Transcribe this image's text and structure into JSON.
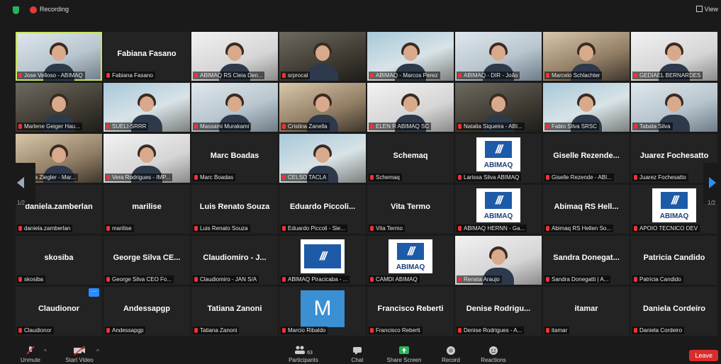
{
  "topbar": {
    "recording_label": "Recording",
    "view_label": "View"
  },
  "pagination": {
    "left_page": "1/2",
    "right_page": "1/2"
  },
  "tiles": [
    {
      "name": "Jose Velloso - ABIMAQ",
      "kind": "video",
      "active": true
    },
    {
      "name": "Fabiana Fasano",
      "kind": "name",
      "display": "Fabiana Fasano"
    },
    {
      "name": "ABIMAQ RS Cleia Den...",
      "kind": "video"
    },
    {
      "name": "srprocal",
      "kind": "video"
    },
    {
      "name": "ABIMAQ - Marcos Perez",
      "kind": "video"
    },
    {
      "name": "ABIMAQ - DIR - João",
      "kind": "video"
    },
    {
      "name": "Marcelo Schlachter",
      "kind": "video"
    },
    {
      "name": "GEDIAEL BERNARDES",
      "kind": "video"
    },
    {
      "name": "Marlene Geiger Hau...",
      "kind": "video"
    },
    {
      "name": "SUELI-SRRR",
      "kind": "video"
    },
    {
      "name": "Massami Murakami",
      "kind": "video"
    },
    {
      "name": "Cristina Zanella",
      "kind": "video"
    },
    {
      "name": "ELEN R ABIMAQ SC",
      "kind": "video"
    },
    {
      "name": "Natalia Siqueira - ABI...",
      "kind": "video"
    },
    {
      "name": "Fabio Silva SRSC",
      "kind": "video"
    },
    {
      "name": "Tabata Silva",
      "kind": "video"
    },
    {
      "name": "Lucia Ziegler - Mar...",
      "kind": "video"
    },
    {
      "name": "Vera Rodrigues - IMP...",
      "kind": "video"
    },
    {
      "name": "Marc Boadas",
      "kind": "name",
      "display": "Marc Boadas"
    },
    {
      "name": "CELSO TACLA",
      "kind": "video"
    },
    {
      "name": "Schemaq",
      "kind": "name",
      "display": "Schemaq"
    },
    {
      "name": "Larissa Silva ABIMAQ",
      "kind": "logo"
    },
    {
      "name": "Giselle Rezende - ABI...",
      "kind": "name",
      "display": "Giselle Rezende..."
    },
    {
      "name": "Juarez Fochesatto",
      "kind": "name",
      "display": "Juarez Fochesatto"
    },
    {
      "name": "daniela.zamberlan",
      "kind": "name",
      "display": "daniela.zamberlan"
    },
    {
      "name": "marilise",
      "kind": "name",
      "display": "marilise"
    },
    {
      "name": "Luis Renato Souza",
      "kind": "name",
      "display": "Luis Renato Souza"
    },
    {
      "name": "Eduardo Piccoli - Sie...",
      "kind": "name",
      "display": "Eduardo Piccoli..."
    },
    {
      "name": "Vita Termo",
      "kind": "name",
      "display": "Vita Termo"
    },
    {
      "name": "ABIMAQ HERNN - Ga...",
      "kind": "logo"
    },
    {
      "name": "Abimaq RS Hellen So...",
      "kind": "name",
      "display": "Abimaq RS Hell..."
    },
    {
      "name": "APOIO TECNICO DEV",
      "kind": "logo"
    },
    {
      "name": "skosiba",
      "kind": "name",
      "display": "skosiba"
    },
    {
      "name": "George Silva CEO Fo...",
      "kind": "name",
      "display": "George Silva CE..."
    },
    {
      "name": "Claudiomiro - JAN S/A",
      "kind": "name",
      "display": "Claudiomiro - J..."
    },
    {
      "name": "ABIMAQ Piracicaba - ...",
      "kind": "logo2"
    },
    {
      "name": "CAMDI ABIMAQ",
      "kind": "logo"
    },
    {
      "name": "Renata Araujo",
      "kind": "video"
    },
    {
      "name": "Sandra Donegatti | A...",
      "kind": "name",
      "display": "Sandra Donegat..."
    },
    {
      "name": "Patricia Candido",
      "kind": "name",
      "display": "Patricia Candido"
    },
    {
      "name": "Claudionor",
      "kind": "name",
      "display": "Claudionor",
      "more": true
    },
    {
      "name": "Andessapgp",
      "kind": "name",
      "display": "Andessapgp"
    },
    {
      "name": "Tatiana Zanoni",
      "kind": "name",
      "display": "Tatiana Zanoni"
    },
    {
      "name": "Marcio Ribaldo",
      "kind": "mcard",
      "initial": "M"
    },
    {
      "name": "Francisco Reberti",
      "kind": "name",
      "display": "Francisco Reberti"
    },
    {
      "name": "Denise Rodrigues - A...",
      "kind": "name",
      "display": "Denise Rodrigu..."
    },
    {
      "name": "itamar",
      "kind": "name",
      "display": "itamar"
    },
    {
      "name": "Daniela Cordeiro",
      "kind": "name",
      "display": "Daniela Cordeiro"
    }
  ],
  "logo_text": "ABIMAQ",
  "logo_mark": "///",
  "toolbar": {
    "unmute": "Unmute",
    "start_video": "Start Video",
    "participants": "Participants",
    "participants_count": "63",
    "chat": "Chat",
    "share_screen": "Share Screen",
    "record": "Record",
    "reactions": "Reactions",
    "leave": "Leave"
  },
  "colors": {
    "accent": "#2d8cff",
    "active_outline": "#c9e265",
    "leave": "#d92d2d",
    "share": "#27b35c"
  }
}
